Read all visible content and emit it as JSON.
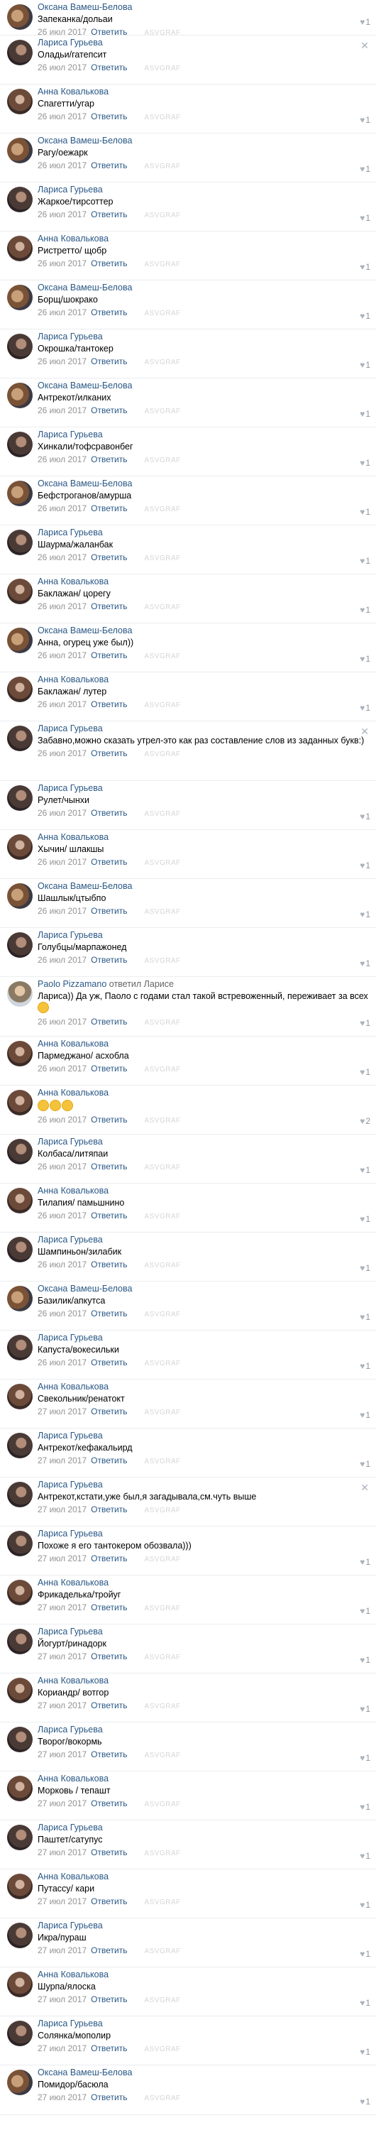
{
  "comments": [
    {
      "author": "Оксана Вамеш-Белова",
      "avatar": "oksana-avatar",
      "text": "Запеканка/дольаи",
      "date": "26 июл 2017",
      "reply_label": "Ответить",
      "likes": "1",
      "h": 50
    },
    {
      "author": "Лариса Гурьева",
      "avatar": "larisa-avatar",
      "text": "Оладьи/гатепсит",
      "date": "26 июл 2017",
      "reply_label": "Ответить",
      "likes": "",
      "close": true,
      "h": 69
    },
    {
      "author": "Анна Ковалькова",
      "avatar": "anna-avatar",
      "text": "Спагетти/угар",
      "date": "26 июл 2017",
      "reply_label": "Ответить",
      "likes": "1",
      "h": 69
    },
    {
      "author": "Оксана Вамеш-Белова",
      "avatar": "oksana-avatar",
      "text": "Рагу/оежарк",
      "date": "26 июл 2017",
      "reply_label": "Ответить",
      "likes": "1",
      "h": 69
    },
    {
      "author": "Лариса Гурьева",
      "avatar": "larisa-avatar",
      "text": "Жаркое/тирсоттер",
      "date": "26 июл 2017",
      "reply_label": "Ответить",
      "likes": "1",
      "h": 69
    },
    {
      "author": "Анна Ковалькова",
      "avatar": "anna-avatar",
      "text": "Ристретто/ щобр",
      "date": "26 июл 2017",
      "reply_label": "Ответить",
      "likes": "1",
      "h": 69
    },
    {
      "author": "Оксана Вамеш-Белова",
      "avatar": "oksana-avatar",
      "text": "Борщ/шокрако",
      "date": "26 июл 2017",
      "reply_label": "Ответить",
      "likes": "1",
      "h": 69
    },
    {
      "author": "Лариса Гурьева",
      "avatar": "larisa-avatar",
      "text": "Окрошка/тантокер",
      "date": "26 июл 2017",
      "reply_label": "Ответить",
      "likes": "1",
      "h": 69
    },
    {
      "author": "Оксана Вамеш-Белова",
      "avatar": "oksana-avatar",
      "text": "Антрекот/илканих",
      "date": "26 июл 2017",
      "reply_label": "Ответить",
      "likes": "1",
      "h": 69
    },
    {
      "author": "Лариса Гурьева",
      "avatar": "larisa-avatar",
      "text": "Хинкали/тофсравонбег",
      "date": "26 июл 2017",
      "reply_label": "Ответить",
      "likes": "1",
      "h": 69
    },
    {
      "author": "Оксана Вамеш-Белова",
      "avatar": "oksana-avatar",
      "text": "Бефстроганов/амурша",
      "date": "26 июл 2017",
      "reply_label": "Ответить",
      "likes": "1",
      "h": 69
    },
    {
      "author": "Лариса Гурьева",
      "avatar": "larisa-avatar",
      "text": "Шаурма/жаланбак",
      "date": "26 июл 2017",
      "reply_label": "Ответить",
      "likes": "1",
      "h": 69
    },
    {
      "author": "Анна Ковалькова",
      "avatar": "anna-avatar",
      "text": "Баклажан/ цорегу",
      "date": "26 июл 2017",
      "reply_label": "Ответить",
      "likes": "1",
      "h": 69
    },
    {
      "author": "Оксана Вамеш-Белова",
      "avatar": "oksana-avatar",
      "text": "Анна, огурец уже был))",
      "date": "26 июл 2017",
      "reply_label": "Ответить",
      "likes": "1",
      "h": 69
    },
    {
      "author": "Анна Ковалькова",
      "avatar": "anna-avatar",
      "text": "Баклажан/ лутер",
      "date": "26 июл 2017",
      "reply_label": "Ответить",
      "likes": "1",
      "h": 69
    },
    {
      "author": "Лариса Гурьева",
      "avatar": "larisa-avatar",
      "text": "Забавно,можно сказать утрел-это как раз составление слов из заданных букв:)",
      "date": "26 июл 2017",
      "reply_label": "Ответить",
      "likes": "",
      "close": true,
      "wrap": true,
      "h": 84
    },
    {
      "author": "Лариса Гурьева",
      "avatar": "larisa-avatar",
      "text": "Рулет/чынхи",
      "date": "26 июл 2017",
      "reply_label": "Ответить",
      "likes": "1",
      "h": 69
    },
    {
      "author": "Анна Ковалькова",
      "avatar": "anna-avatar",
      "text": "Хычин/ шлакшы",
      "date": "26 июл 2017",
      "reply_label": "Ответить",
      "likes": "1",
      "h": 69
    },
    {
      "author": "Оксана Вамеш-Белова",
      "avatar": "oksana-avatar",
      "text": "Шашлык/цтыбпо",
      "date": "26 июл 2017",
      "reply_label": "Ответить",
      "likes": "1",
      "h": 69
    },
    {
      "author": "Лариса Гурьева",
      "avatar": "larisa-avatar",
      "text": "Голубцы/марпажонед",
      "date": "26 июл 2017",
      "reply_label": "Ответить",
      "likes": "1",
      "h": 69
    },
    {
      "author": "Paolo Pizzamano",
      "reply_to": "ответил Ларисе",
      "avatar": "paolo-avatar",
      "text": "Лариса)) Да уж, Паоло с годами стал такой встревоженный, переживает за всех",
      "emoji": 1,
      "date": "26 июл 2017",
      "reply_label": "Ответить",
      "likes": "1",
      "wrap": true,
      "h": 84
    },
    {
      "author": "Анна Ковалькова",
      "avatar": "anna-avatar",
      "text": "Пармеджано/ асхобла",
      "date": "26 июл 2017",
      "reply_label": "Ответить",
      "likes": "1",
      "h": 69
    },
    {
      "author": "Анна Ковалькова",
      "avatar": "anna-avatar",
      "text": "",
      "emoji": 3,
      "date": "26 июл 2017",
      "reply_label": "Ответить",
      "likes": "2",
      "h": 69
    },
    {
      "author": "Лариса Гурьева",
      "avatar": "larisa-avatar",
      "text": "Колбаса/литяпаи",
      "date": "26 июл 2017",
      "reply_label": "Ответить",
      "likes": "1",
      "h": 69
    },
    {
      "author": "Анна Ковалькова",
      "avatar": "anna-avatar",
      "text": "Тилапия/ памьшнино",
      "date": "26 июл 2017",
      "reply_label": "Ответить",
      "likes": "1",
      "h": 69
    },
    {
      "author": "Лариса Гурьева",
      "avatar": "larisa-avatar",
      "text": "Шампиньон/зилабик",
      "date": "26 июл 2017",
      "reply_label": "Ответить",
      "likes": "1",
      "h": 69
    },
    {
      "author": "Оксана Вамеш-Белова",
      "avatar": "oksana-avatar",
      "text": "Базилик/апкутса",
      "date": "26 июл 2017",
      "reply_label": "Ответить",
      "likes": "1",
      "h": 69
    },
    {
      "author": "Лариса Гурьева",
      "avatar": "larisa-avatar",
      "text": "Капуста/вокесильки",
      "date": "26 июл 2017",
      "reply_label": "Ответить",
      "likes": "1",
      "h": 69
    },
    {
      "author": "Анна Ковалькова",
      "avatar": "anna-avatar",
      "text": "Свекольник/ренатокт",
      "date": "27 июл 2017",
      "reply_label": "Ответить",
      "likes": "1",
      "h": 69
    },
    {
      "author": "Лариса Гурьева",
      "avatar": "larisa-avatar",
      "text": "Антрекот/кефакальирд",
      "date": "27 июл 2017",
      "reply_label": "Ответить",
      "likes": "1",
      "h": 69
    },
    {
      "author": "Лариса Гурьева",
      "avatar": "larisa-avatar",
      "text": "Антрекот,кстати,уже был,я загадывала,см.чуть выше",
      "date": "27 июл 2017",
      "reply_label": "Ответить",
      "likes": "",
      "close": true,
      "h": 69
    },
    {
      "author": "Лариса Гурьева",
      "avatar": "larisa-avatar",
      "text": "Похоже я его тантокером обозвала)))",
      "date": "27 июл 2017",
      "reply_label": "Ответить",
      "likes": "1",
      "h": 69
    },
    {
      "author": "Анна Ковалькова",
      "avatar": "anna-avatar",
      "text": "Фрикаделька/тройуг",
      "date": "27 июл 2017",
      "reply_label": "Ответить",
      "likes": "1",
      "h": 69
    },
    {
      "author": "Лариса Гурьева",
      "avatar": "larisa-avatar",
      "text": "Йогурт/ринадорк",
      "date": "27 июл 2017",
      "reply_label": "Ответить",
      "likes": "1",
      "h": 69
    },
    {
      "author": "Анна Ковалькова",
      "avatar": "anna-avatar",
      "text": "Кориандр/ вотгор",
      "date": "27 июл 2017",
      "reply_label": "Ответить",
      "likes": "1",
      "h": 69
    },
    {
      "author": "Лариса Гурьева",
      "avatar": "larisa-avatar",
      "text": "Творог/вокормь",
      "date": "27 июл 2017",
      "reply_label": "Ответить",
      "likes": "1",
      "h": 69
    },
    {
      "author": "Анна Ковалькова",
      "avatar": "anna-avatar",
      "text": "Морковь / тепашт",
      "date": "27 июл 2017",
      "reply_label": "Ответить",
      "likes": "1",
      "h": 69
    },
    {
      "author": "Лариса Гурьева",
      "avatar": "larisa-avatar",
      "text": "Паштет/сатупус",
      "date": "27 июл 2017",
      "reply_label": "Ответить",
      "likes": "1",
      "h": 69
    },
    {
      "author": "Анна Ковалькова",
      "avatar": "anna-avatar",
      "text": "Путассу/ кари",
      "date": "27 июл 2017",
      "reply_label": "Ответить",
      "likes": "1",
      "h": 69
    },
    {
      "author": "Лариса Гурьева",
      "avatar": "larisa-avatar",
      "text": "Икра/пураш",
      "date": "27 июл 2017",
      "reply_label": "Ответить",
      "likes": "1",
      "h": 69
    },
    {
      "author": "Анна Ковалькова",
      "avatar": "anna-avatar",
      "text": "Шурпа/ялоска",
      "date": "27 июл 2017",
      "reply_label": "Ответить",
      "likes": "1",
      "h": 69
    },
    {
      "author": "Лариса Гурьева",
      "avatar": "larisa-avatar",
      "text": "Солянка/мополир",
      "date": "27 июл 2017",
      "reply_label": "Ответить",
      "likes": "1",
      "h": 69
    },
    {
      "author": "Оксана Вамеш-Белова",
      "avatar": "oksana-avatar",
      "text": "Помидор/басюла",
      "date": "27 июл 2017",
      "reply_label": "Ответить",
      "likes": "1",
      "h": 70
    }
  ],
  "watermark": "ASVGRAF",
  "colors": {
    "link": "#2a5885",
    "meta": "#939393",
    "divider": "#ebedf0"
  }
}
